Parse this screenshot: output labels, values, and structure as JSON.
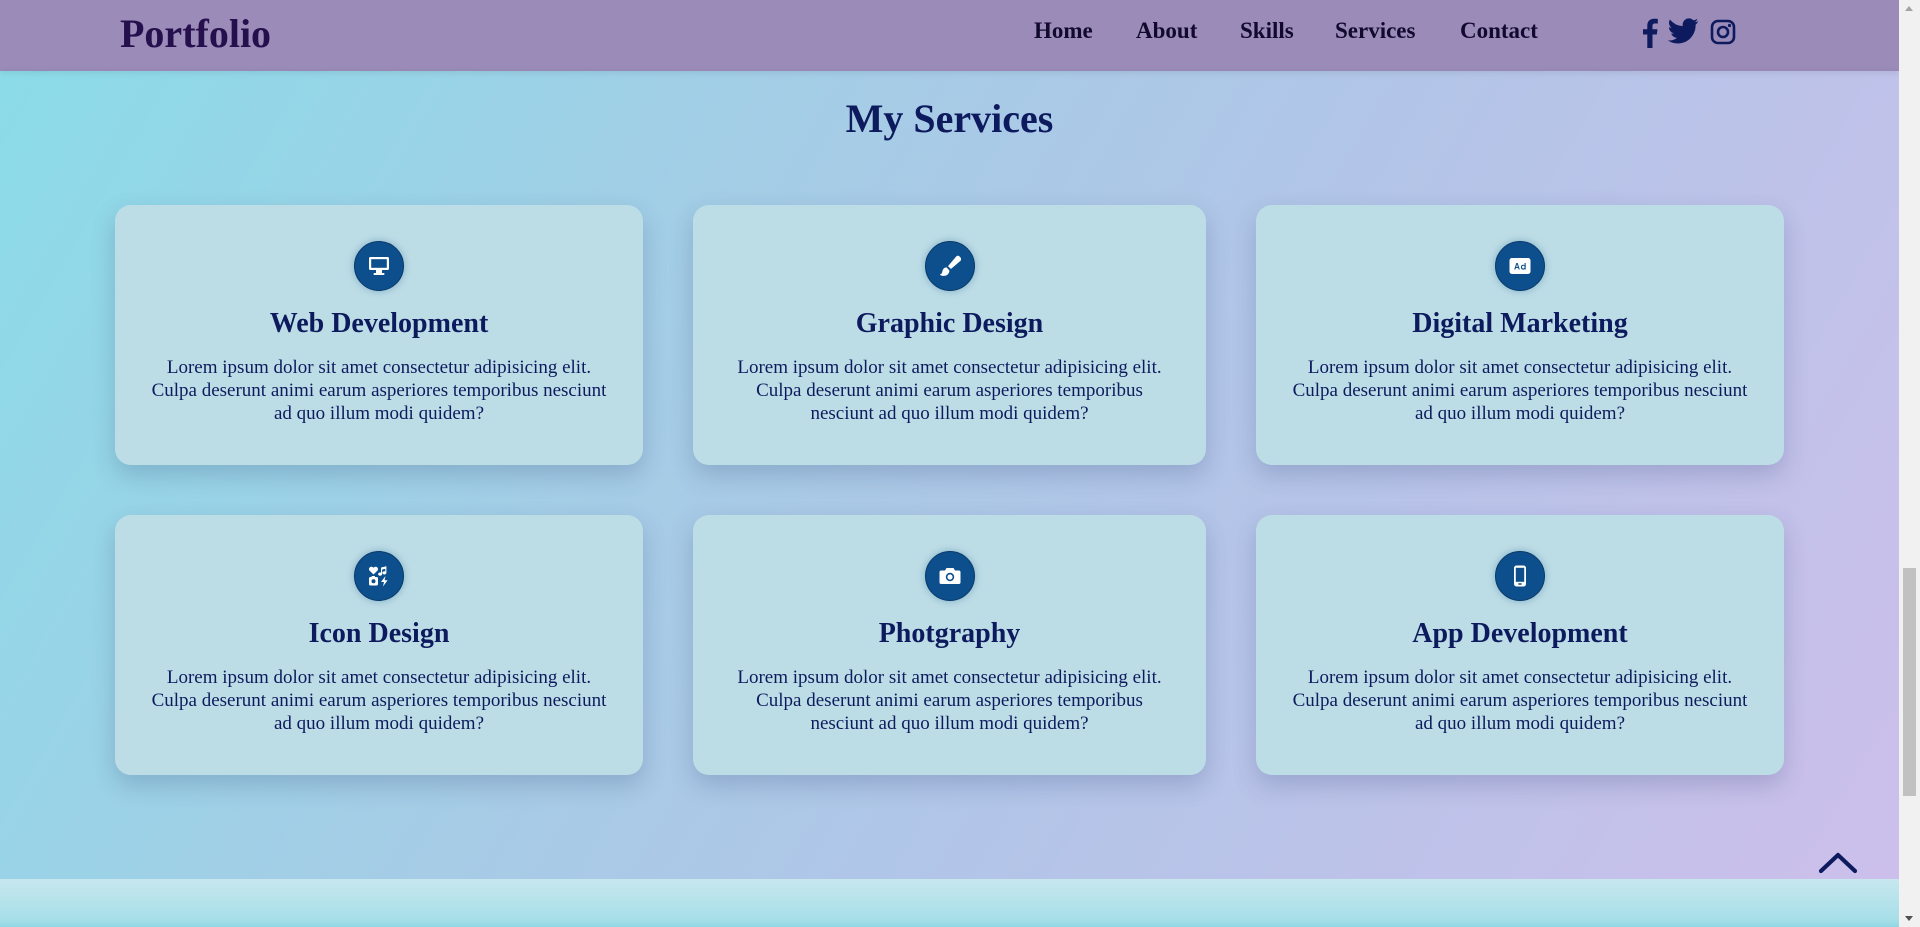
{
  "navbar": {
    "logo": "Portfolio",
    "links": [
      "Home",
      "About",
      "Skills",
      "Services",
      "Contact"
    ],
    "socials": [
      "facebook-icon",
      "twitter-icon",
      "instagram-icon"
    ]
  },
  "services": {
    "title": "My Services",
    "cards": [
      {
        "title": "Web Development",
        "icon": "monitor-icon",
        "text": "Lorem ipsum dolor sit amet consectetur adipisicing elit. Culpa deserunt animi earum asperiores temporibus nesciunt ad quo illum modi quidem?"
      },
      {
        "title": "Graphic Design",
        "icon": "paintbrush-icon",
        "text": "Lorem ipsum dolor sit amet consectetur adipisicing elit. Culpa deserunt animi earum asperiores temporibus nesciunt ad quo illum modi quidem?"
      },
      {
        "title": "Digital Marketing",
        "icon": "ad-icon",
        "text": "Lorem ipsum dolor sit amet consectetur adipisicing elit. Culpa deserunt animi earum asperiores temporibus nesciunt ad quo illum modi quidem?"
      },
      {
        "title": "Icon Design",
        "icon": "icons-icon",
        "text": "Lorem ipsum dolor sit amet consectetur adipisicing elit. Culpa deserunt animi earum asperiores temporibus nesciunt ad quo illum modi quidem?"
      },
      {
        "title": "Photgraphy",
        "icon": "camera-icon",
        "text": "Lorem ipsum dolor sit amet consectetur adipisicing elit. Culpa deserunt animi earum asperiores temporibus nesciunt ad quo illum modi quidem?"
      },
      {
        "title": "App Development",
        "icon": "mobile-icon",
        "text": "Lorem ipsum dolor sit amet consectetur adipisicing elit. Culpa deserunt animi earum asperiores temporibus nesciunt ad quo illum modi quidem?"
      }
    ]
  },
  "back_to_top": {
    "icon": "chevron-up-icon"
  },
  "colors": {
    "navbar_bg": "#9b8bb9",
    "text_dark_blue": "#0d1b5e",
    "card_bg": "#bddde6",
    "icon_circle": "#0c4f8c"
  }
}
